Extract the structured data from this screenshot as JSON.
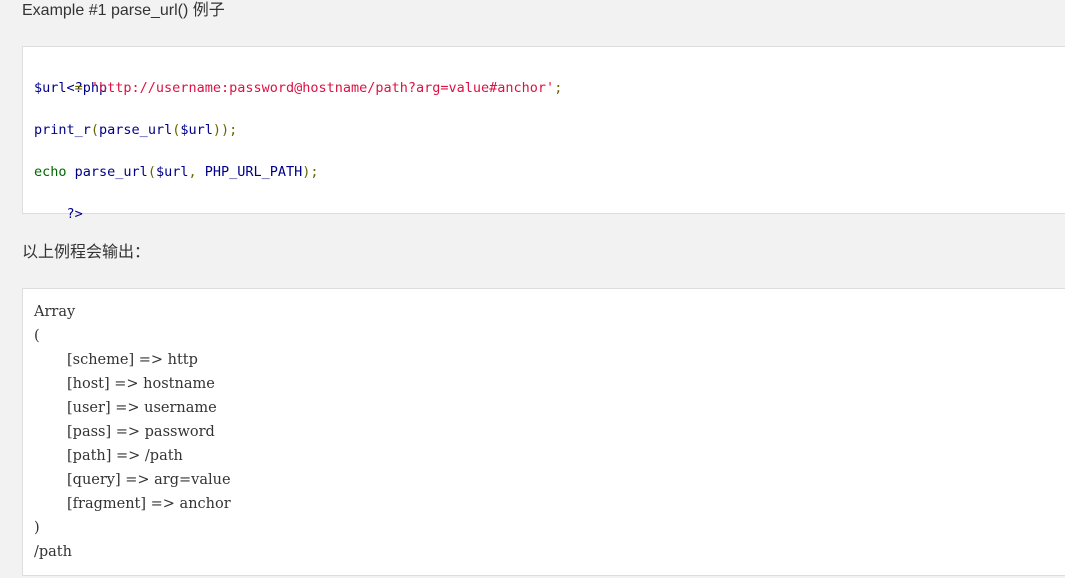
{
  "example_heading": "Example #1 parse_url() 例子",
  "code": {
    "open_tag": "<?php",
    "line2": {
      "var": "$url",
      "op": " = ",
      "str": "'http://username:password@hostname/path?arg=value#anchor'",
      "end": ";"
    },
    "line4": {
      "fn": "print_r",
      "p1": "(",
      "fn2": "parse_url",
      "p2": "(",
      "var": "$url",
      "end": "));"
    },
    "line6": {
      "kw": "echo",
      "sp": " ",
      "fn": "parse_url",
      "p1": "(",
      "var": "$url",
      "comma": ", ",
      "const": "PHP_URL_PATH",
      "end": ");"
    },
    "close_tag": "?>"
  },
  "output_label": "以上例程会输出：",
  "output": {
    "lines": [
      "Array",
      "(",
      "[scheme] => http",
      "[host] => hostname",
      "[user] => username",
      "[pass] => password",
      "[path] => /path",
      "[query] => arg=value",
      "[fragment] => anchor",
      ")",
      "/path"
    ]
  }
}
